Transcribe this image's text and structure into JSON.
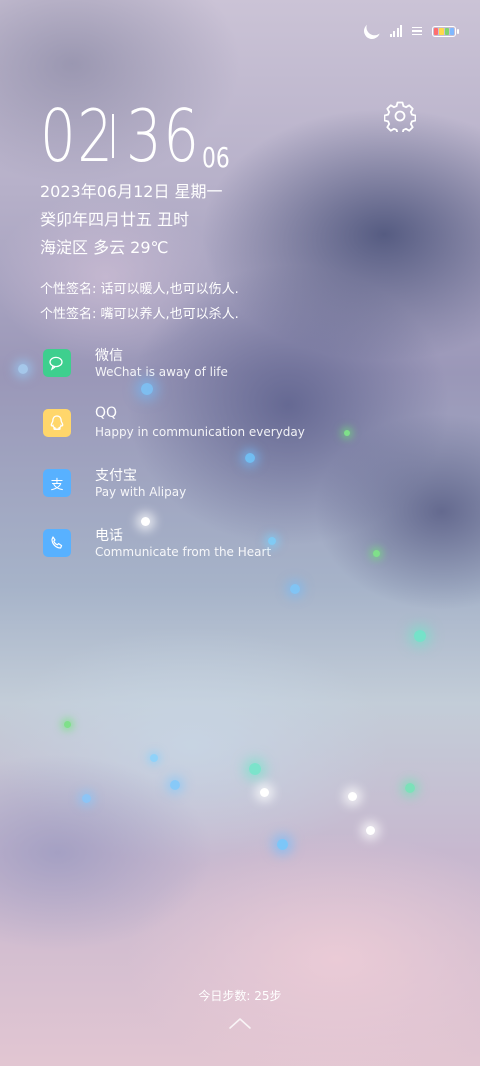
{
  "status_bar": {
    "moon_icon": "moon-icon",
    "signal_icon": "signal-icon",
    "wifi_icon": "wifi-icon",
    "battery_icon": "battery-icon"
  },
  "settings_icon": "gear-icon",
  "clock": {
    "hour": "02",
    "minute": "36",
    "second": "06"
  },
  "date_line": "2023年06月12日 星期一",
  "lunar_line": "癸卯年四月廿五 丑时",
  "weather_line": "海淀区  多云  29℃",
  "signatures": [
    "个性签名: 话可以暖人,也可以伤人.",
    "个性签名: 嘴可以养人,也可以杀人."
  ],
  "apps": [
    {
      "name": "微信",
      "desc": "WeChat is away of life",
      "icon": "wechat-icon",
      "color": "#3ecf8e"
    },
    {
      "name": "QQ",
      "desc": "Happy in communication everyday",
      "icon": "qq-icon",
      "color": "#ffd66b"
    },
    {
      "name": "支付宝",
      "desc": "Pay with Alipay",
      "icon": "alipay-icon",
      "glyph": "支",
      "color": "#58b1ff"
    },
    {
      "name": "电话",
      "desc": "Communicate from the Heart",
      "icon": "phone-icon",
      "color": "#58b1ff"
    }
  ],
  "steps_label": "今日步数: 25步",
  "unlock_icon": "chevron-up-icon",
  "battery_colors": [
    "#ff6e6e",
    "#ffd84a",
    "#7fd46e",
    "#7fb8ff"
  ]
}
